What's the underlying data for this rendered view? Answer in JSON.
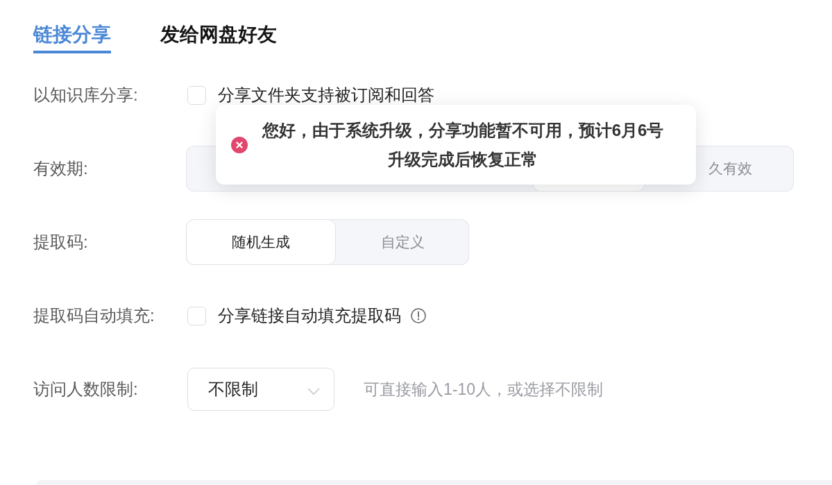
{
  "tabs": [
    {
      "label": "链接分享",
      "selected": true
    },
    {
      "label": "发给网盘好友",
      "selected": false
    }
  ],
  "form": [
    {
      "kind": "checkbox",
      "label": "以知识库分享:",
      "option": "分享文件夹支持被订阅和回答",
      "checked": false
    },
    {
      "kind": "segmented",
      "label": "有效期:",
      "options": [
        {
          "selected": true
        },
        {
          "label": "久有效",
          "selected": false
        }
      ]
    },
    {
      "kind": "segmented",
      "label": "提取码:",
      "options": [
        {
          "label": "随机生成",
          "selected": true
        },
        {
          "label": "自定义",
          "selected": false
        }
      ]
    },
    {
      "kind": "checkbox",
      "label": "提取码自动填充:",
      "option": "分享链接自动填充提取码",
      "checked": false,
      "info": true
    },
    {
      "kind": "select",
      "label": "访问人数限制:",
      "value": "不限制",
      "hint": "可直接输入1-10人，或选择不限制"
    }
  ],
  "toast": {
    "kind": "error",
    "message": "您好，由于系统升级，分享功能暂不可用，预计6月6号升级完成后恢复正常"
  }
}
